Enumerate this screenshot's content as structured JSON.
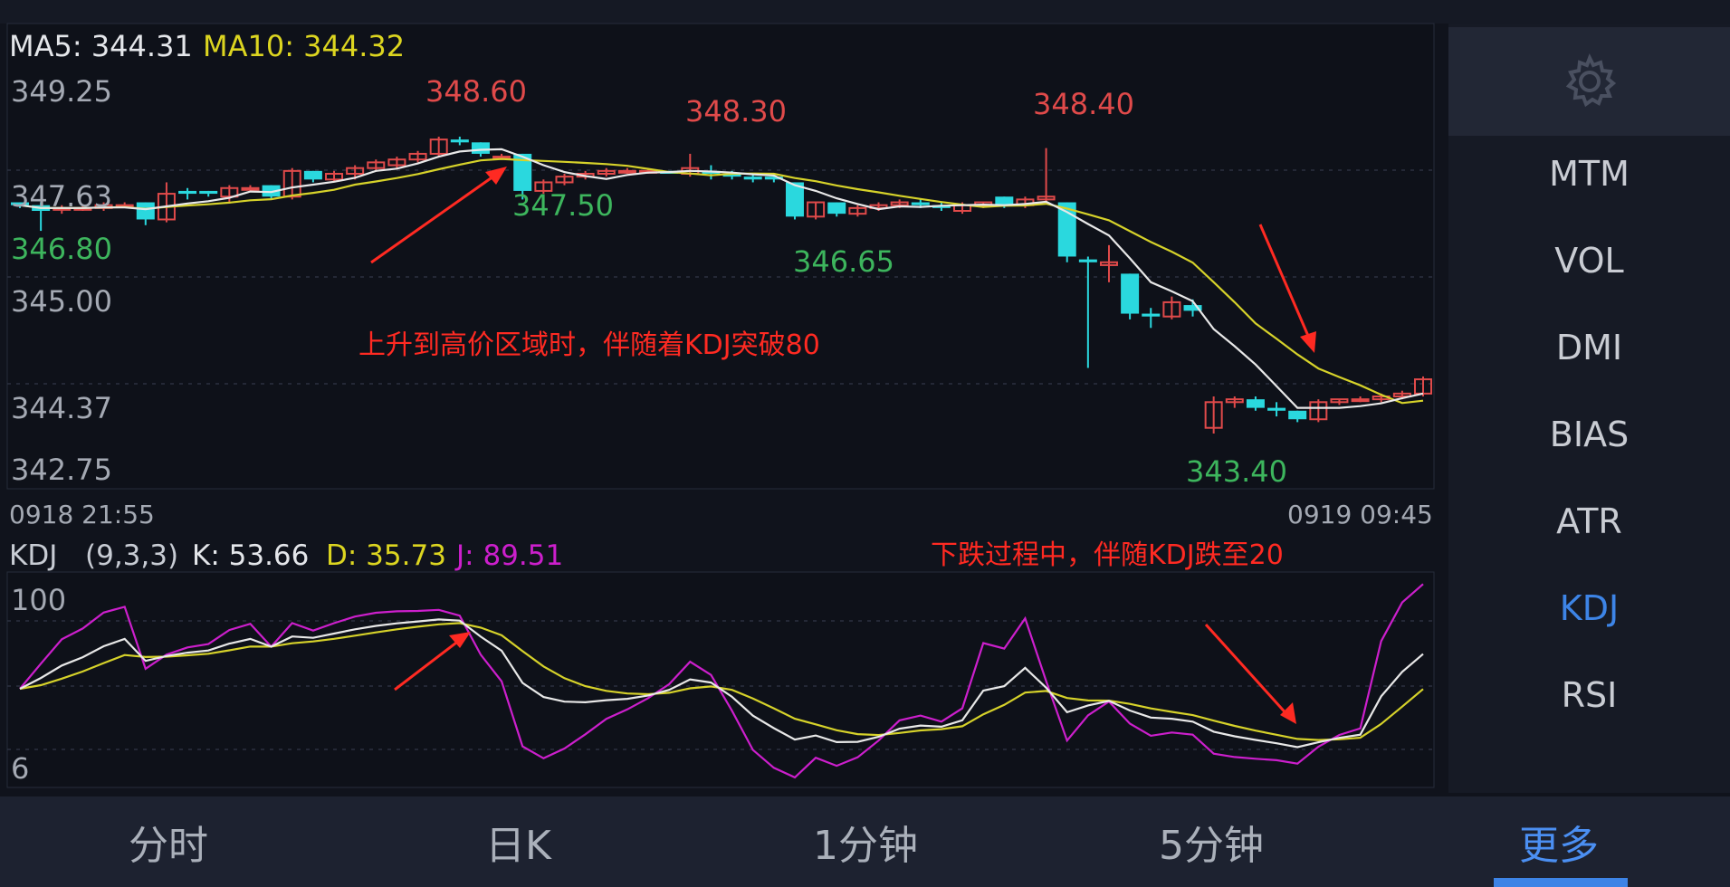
{
  "ma": {
    "ma5_label": "MA5: 344.31",
    "ma10_label": "MA10: 344.32"
  },
  "price_axis": [
    "349.25",
    "347.63",
    "346.80",
    "345.00",
    "344.37",
    "342.75"
  ],
  "price_labels": {
    "high1": "348.60",
    "high2": "348.30",
    "high3": "348.40",
    "low1": "347.50",
    "low2": "346.65",
    "low3": "343.40"
  },
  "time_axis": {
    "start": "0918 21:55",
    "end": "0919 09:45"
  },
  "kdj": {
    "name": "KDJ",
    "params": "(9,3,3)",
    "k": "K: 53.66",
    "d": "D: 35.73",
    "j": "J: 89.51",
    "axis_top": "100",
    "axis_bottom": "6"
  },
  "annotations": {
    "rise": "上升到高价区域时，伴随着KDJ突破80",
    "fall": "下跌过程中，伴随KDJ跌至20"
  },
  "side_menu": {
    "items": [
      "MTM",
      "VOL",
      "DMI",
      "BIAS",
      "ATR",
      "KDJ",
      "RSI"
    ],
    "active": "KDJ"
  },
  "tabs": [
    "分时",
    "日K",
    "1分钟",
    "5分钟",
    "更多"
  ],
  "active_tab": "更多",
  "colors": {
    "up": "#e04a4a",
    "down": "#2ad8de",
    "ma5": "#e8e8e8",
    "ma10": "#d6d22a",
    "j_line": "#cc1fcc",
    "accent": "#3d84e6",
    "annot": "#ff2a22"
  },
  "candles": [
    [
      347.45,
      347.45,
      347.35,
      347.4
    ],
    [
      347.4,
      347.45,
      346.95,
      347.3
    ],
    [
      347.35,
      347.4,
      347.25,
      347.35
    ],
    [
      347.35,
      347.4,
      347.3,
      347.35
    ],
    [
      347.35,
      347.45,
      347.3,
      347.4
    ],
    [
      347.4,
      347.45,
      347.35,
      347.4
    ],
    [
      347.45,
      347.45,
      347.05,
      347.15
    ],
    [
      347.15,
      347.8,
      347.1,
      347.6
    ],
    [
      347.65,
      347.7,
      347.5,
      347.6
    ],
    [
      347.65,
      347.65,
      347.55,
      347.6
    ],
    [
      347.55,
      347.75,
      347.45,
      347.7
    ],
    [
      347.7,
      347.75,
      347.65,
      347.7
    ],
    [
      347.75,
      347.75,
      347.5,
      347.55
    ],
    [
      347.55,
      348.05,
      347.5,
      348.0
    ],
    [
      348.0,
      348.0,
      347.8,
      347.85
    ],
    [
      347.85,
      348.0,
      347.8,
      347.95
    ],
    [
      347.95,
      348.1,
      347.85,
      348.05
    ],
    [
      348.05,
      348.2,
      348.0,
      348.15
    ],
    [
      348.1,
      348.25,
      348.05,
      348.2
    ],
    [
      348.2,
      348.35,
      348.15,
      348.3
    ],
    [
      348.3,
      348.6,
      348.25,
      348.55
    ],
    [
      348.55,
      348.6,
      348.45,
      348.5
    ],
    [
      348.5,
      348.5,
      348.25,
      348.3
    ],
    [
      348.25,
      348.3,
      348.2,
      348.25
    ],
    [
      348.3,
      348.3,
      347.5,
      347.65
    ],
    [
      347.65,
      347.85,
      347.6,
      347.8
    ],
    [
      347.8,
      347.95,
      347.75,
      347.9
    ],
    [
      347.9,
      348.0,
      347.85,
      347.95
    ],
    [
      347.95,
      348.05,
      347.9,
      348.0
    ],
    [
      348.0,
      348.05,
      347.95,
      348.0
    ],
    [
      348.0,
      348.05,
      347.95,
      348.0
    ],
    [
      348.0,
      348.0,
      347.95,
      347.95
    ],
    [
      347.95,
      348.3,
      347.9,
      348.05
    ],
    [
      348.0,
      348.1,
      347.85,
      347.95
    ],
    [
      347.95,
      348.0,
      347.85,
      347.9
    ],
    [
      347.9,
      347.95,
      347.8,
      347.85
    ],
    [
      347.9,
      347.95,
      347.8,
      347.85
    ],
    [
      347.8,
      347.8,
      347.15,
      347.2
    ],
    [
      347.2,
      347.45,
      347.15,
      347.45
    ],
    [
      347.45,
      347.45,
      347.2,
      347.25
    ],
    [
      347.25,
      347.4,
      347.2,
      347.35
    ],
    [
      347.35,
      347.45,
      347.3,
      347.4
    ],
    [
      347.4,
      347.5,
      347.35,
      347.45
    ],
    [
      347.45,
      347.5,
      347.35,
      347.4
    ],
    [
      347.4,
      347.45,
      347.3,
      347.35
    ],
    [
      347.3,
      347.45,
      347.25,
      347.4
    ],
    [
      347.4,
      347.45,
      347.35,
      347.45
    ],
    [
      347.55,
      347.55,
      347.35,
      347.4
    ],
    [
      347.4,
      347.55,
      347.35,
      347.5
    ],
    [
      347.5,
      348.4,
      347.45,
      347.55
    ],
    [
      347.45,
      347.45,
      346.4,
      346.5
    ],
    [
      346.45,
      346.5,
      344.55,
      346.4
    ],
    [
      346.35,
      346.7,
      346.05,
      346.4
    ],
    [
      346.2,
      346.2,
      345.4,
      345.5
    ],
    [
      345.5,
      345.6,
      345.25,
      345.45
    ],
    [
      345.45,
      345.8,
      345.4,
      345.7
    ],
    [
      345.65,
      345.75,
      345.45,
      345.55
    ],
    [
      343.5,
      344.05,
      343.4,
      343.95
    ],
    [
      343.95,
      344.05,
      343.85,
      344.0
    ],
    [
      344.0,
      344.05,
      343.8,
      343.85
    ],
    [
      343.85,
      343.95,
      343.7,
      343.8
    ],
    [
      343.8,
      343.8,
      343.6,
      343.65
    ],
    [
      343.65,
      344.0,
      343.6,
      343.95
    ],
    [
      343.95,
      344.0,
      343.9,
      344.0
    ],
    [
      344.0,
      344.05,
      343.95,
      344.0
    ],
    [
      344.0,
      344.1,
      343.95,
      344.05
    ],
    [
      344.05,
      344.15,
      344.0,
      344.1
    ],
    [
      344.1,
      344.4,
      344.05,
      344.35
    ]
  ]
}
